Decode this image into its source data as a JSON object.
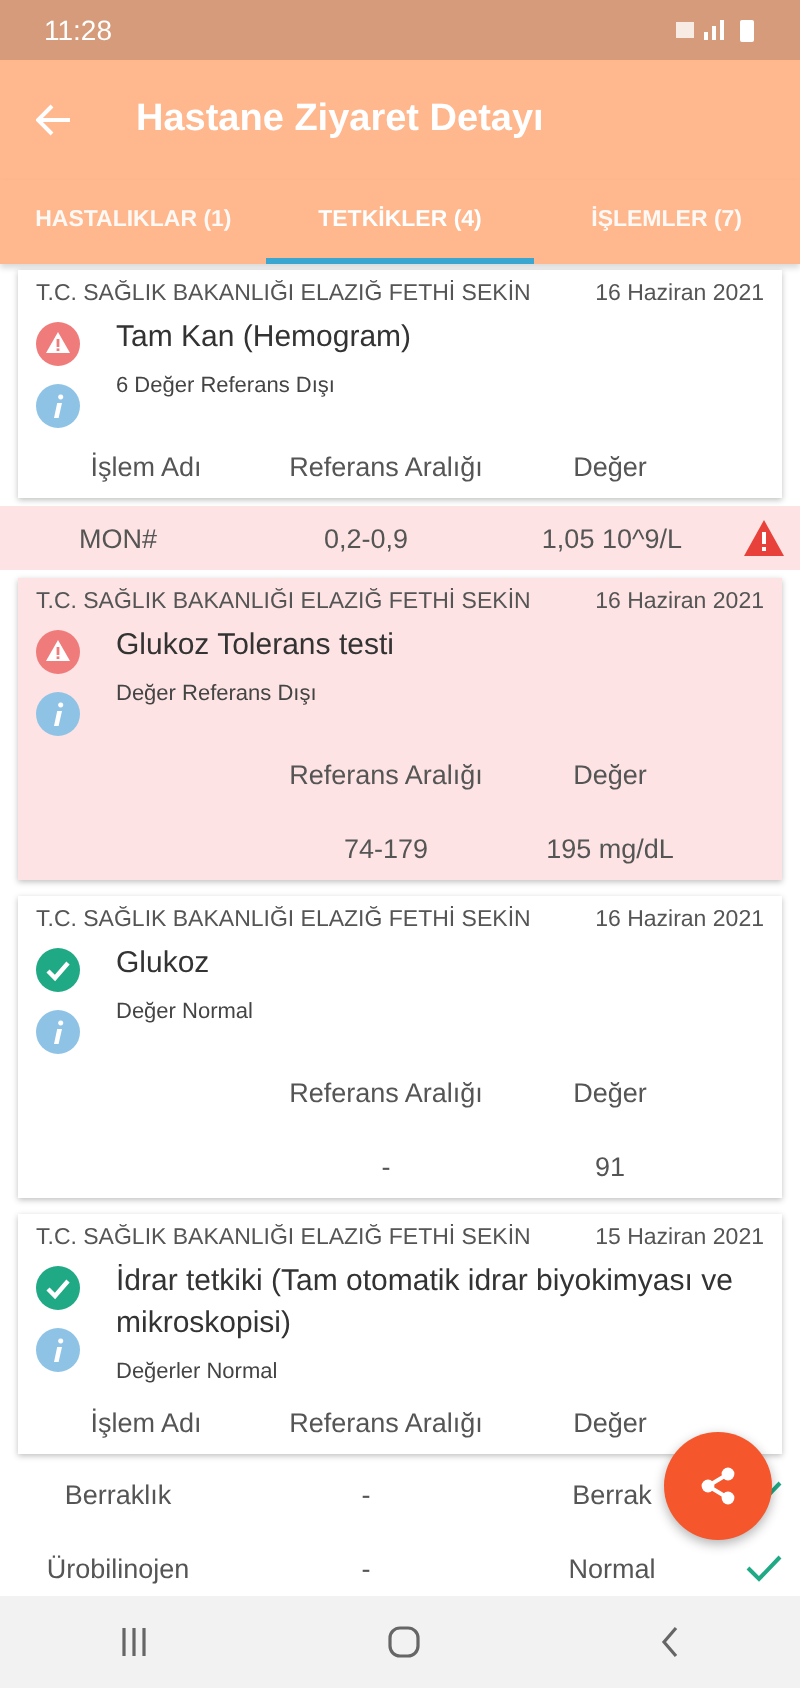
{
  "status_bar": {
    "time": "11:28"
  },
  "app_bar": {
    "title": "Hastane Ziyaret Detayı"
  },
  "tabs": [
    {
      "label": "HASTALIKLAR (1)",
      "selected": false
    },
    {
      "label": "TETKİKLER (4)",
      "selected": true
    },
    {
      "label": "İŞLEMLER (7)",
      "selected": false
    }
  ],
  "tests": [
    {
      "institution": "T.C. SAĞLIK BAKANLIĞI ELAZIĞ FETHİ SEKİN",
      "date": "16 Haziran 2021",
      "kind": "warning",
      "flagged": false,
      "title": "Tam Kan (Hemogram)",
      "summary": "6 Değer Referans Dışı",
      "headers": {
        "name": "İşlem Adı",
        "reference": "Referans Aralığı",
        "value": "Değer"
      },
      "results": [
        {
          "name": "MON#",
          "reference": "0,2-0,9",
          "value": "1,05 10^9/L",
          "out_of_range": true
        }
      ]
    },
    {
      "institution": "T.C. SAĞLIK BAKANLIĞI ELAZIĞ FETHİ SEKİN",
      "date": "16 Haziran 2021",
      "kind": "warning",
      "flagged": true,
      "title": "Glukoz Tolerans testi",
      "summary": "Değer Referans Dışı",
      "headers": {
        "reference": "Referans Aralığı",
        "value": "Değer"
      },
      "rows": [
        {
          "reference": "74-179",
          "value": "195 mg/dL"
        }
      ]
    },
    {
      "institution": "T.C. SAĞLIK BAKANLIĞI ELAZIĞ FETHİ SEKİN",
      "date": "16 Haziran 2021",
      "kind": "ok",
      "flagged": false,
      "title": "Glukoz",
      "summary": "Değer Normal",
      "headers": {
        "reference": "Referans Aralığı",
        "value": "Değer"
      },
      "rows": [
        {
          "reference": "-",
          "value": "91"
        }
      ]
    },
    {
      "institution": "T.C. SAĞLIK BAKANLIĞI ELAZIĞ FETHİ SEKİN",
      "date": "15 Haziran 2021",
      "kind": "ok",
      "flagged": false,
      "title": "İdrar tetkiki (Tam otomatik idrar biyokimyası ve mikroskopisi)",
      "summary": "Değerler Normal",
      "headers": {
        "name": "İşlem Adı",
        "reference": "Referans Aralığı",
        "value": "Değer"
      },
      "results": [
        {
          "name": "Berraklık",
          "reference": "-",
          "value": "Berrak",
          "out_of_range": false
        },
        {
          "name": "Ürobilinojen",
          "reference": "-",
          "value": "Normal",
          "out_of_range": false
        }
      ]
    }
  ]
}
